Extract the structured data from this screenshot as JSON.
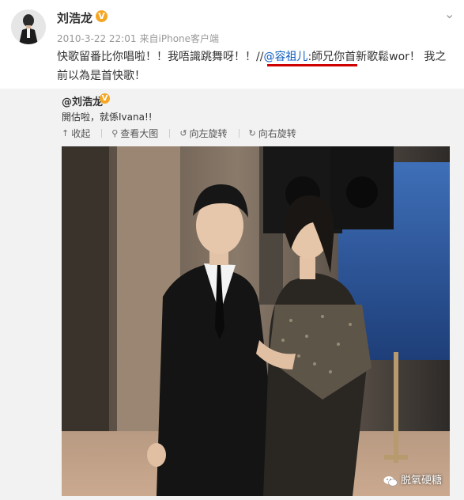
{
  "post": {
    "username": "刘浩龙",
    "verified_mark": "V",
    "timestamp": "2010-3-22 22:01",
    "source_prefix": "来自",
    "source": "iPhone客户端",
    "text_before": "快歌留番比你唱啦！！我唔識跳舞呀！！//",
    "mention": "@容祖儿",
    "text_after": ":師兄你首新歌鬆wor！ 我之前以為是首快歌！"
  },
  "quoted": {
    "username": "@刘浩龙",
    "verified_mark": "V",
    "text": "開估啦，就係Ivana!!",
    "toolbar": {
      "collect_label": "收起",
      "view_large_label": "查看大图",
      "rotate_left_label": "向左旋转",
      "rotate_right_label": "向右旋转"
    }
  },
  "watermark": "脱氧硬糖",
  "icons": {
    "collect": "collapse-icon",
    "view_large": "zoom-in-icon",
    "rotate_left": "rotate-left-icon",
    "rotate_right": "rotate-right-icon",
    "verified": "verified-badge-icon",
    "more": "chevron-down-icon",
    "watermark_logo": "wechat-logo-icon"
  },
  "colors": {
    "link": "#0a5bbf",
    "verified": "#f5a623",
    "highlight_underline": "#d10000",
    "quoted_bg": "#f2f2f2"
  }
}
